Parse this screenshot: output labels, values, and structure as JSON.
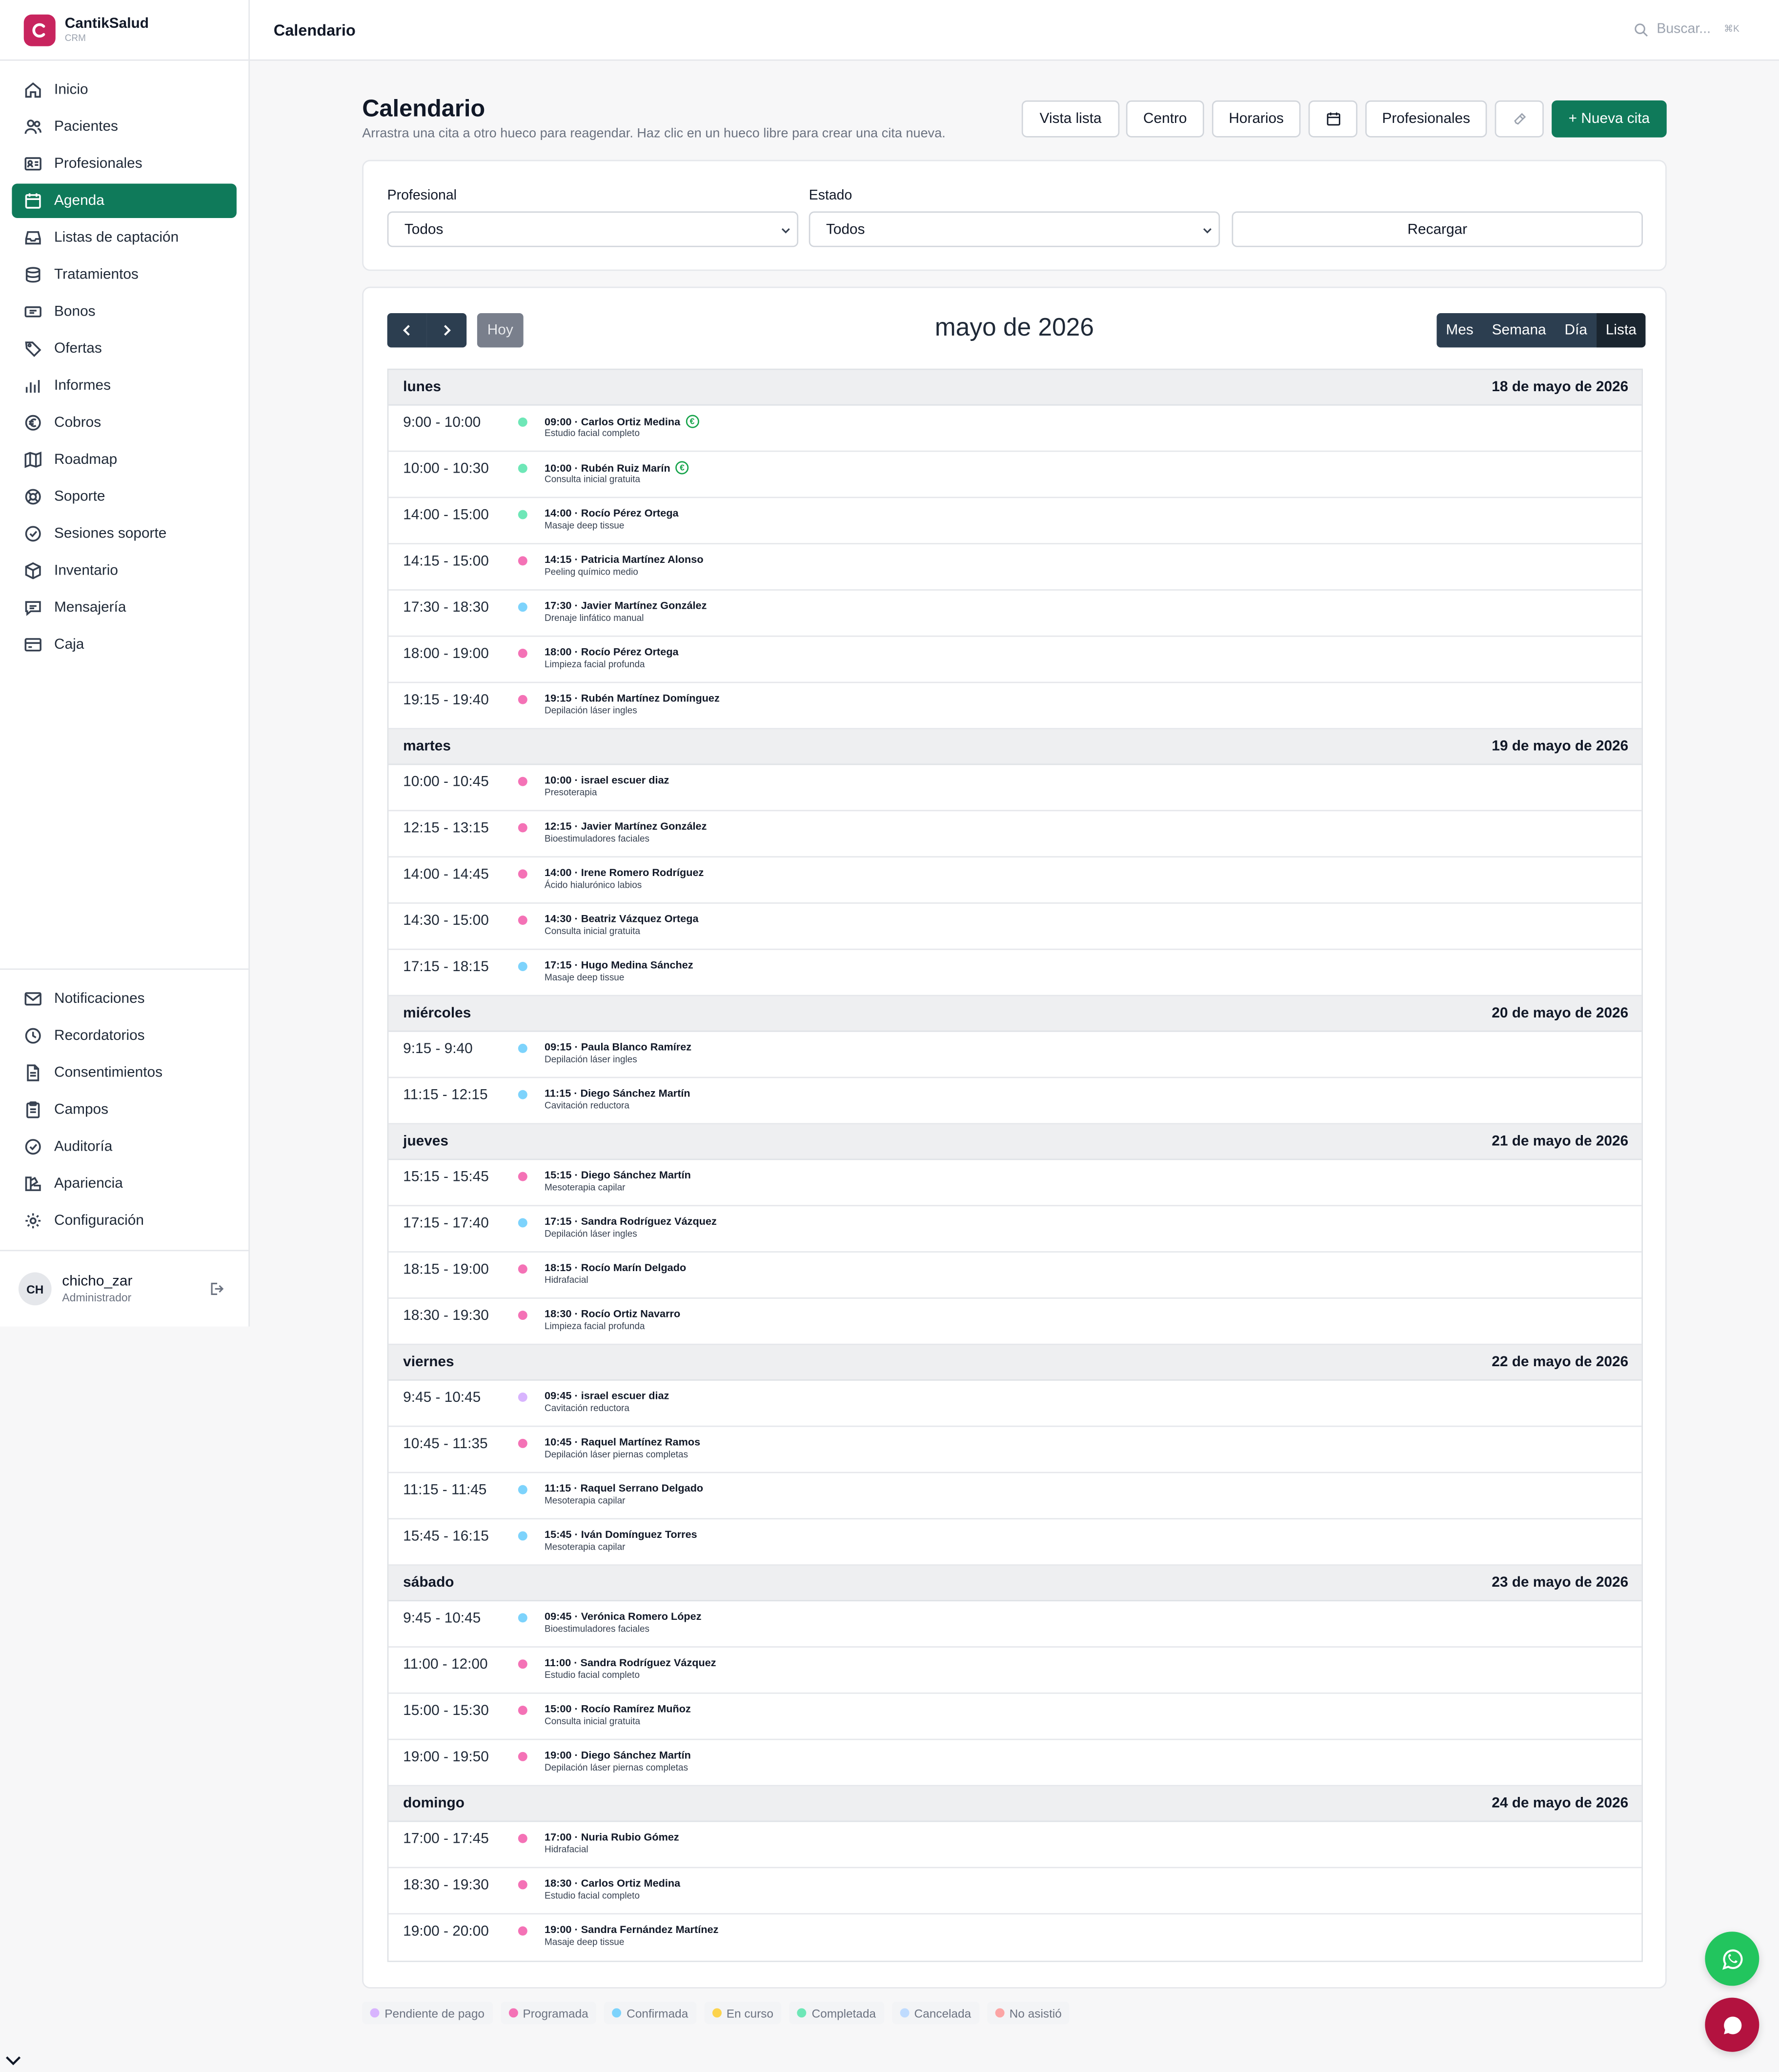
{
  "brand": {
    "name": "CantikSalud",
    "sub": "CRM"
  },
  "topbar": {
    "title": "Calendario",
    "search_placeholder": "Buscar...",
    "shortcut": "⌘K"
  },
  "sidebar": {
    "items": [
      {
        "label": "Inicio",
        "icon": "home-icon"
      },
      {
        "label": "Pacientes",
        "icon": "users-icon"
      },
      {
        "label": "Profesionales",
        "icon": "id-card-icon"
      },
      {
        "label": "Agenda",
        "icon": "calendar-icon",
        "active": true
      },
      {
        "label": "Listas de captación",
        "icon": "inbox-icon"
      },
      {
        "label": "Tratamientos",
        "icon": "database-icon"
      },
      {
        "label": "Bonos",
        "icon": "ticket-icon"
      },
      {
        "label": "Ofertas",
        "icon": "tag-icon"
      },
      {
        "label": "Informes",
        "icon": "chart-icon"
      },
      {
        "label": "Cobros",
        "icon": "euro-icon"
      },
      {
        "label": "Roadmap",
        "icon": "map-icon"
      },
      {
        "label": "Soporte",
        "icon": "lifebuoy-icon"
      },
      {
        "label": "Sesiones soporte",
        "icon": "check-circle-icon"
      },
      {
        "label": "Inventario",
        "icon": "box-icon"
      },
      {
        "label": "Mensajería",
        "icon": "message-icon"
      },
      {
        "label": "Caja",
        "icon": "wallet-icon"
      }
    ],
    "bottom_items": [
      {
        "label": "Notificaciones",
        "icon": "mail-icon"
      },
      {
        "label": "Recordatorios",
        "icon": "clock-icon"
      },
      {
        "label": "Consentimientos",
        "icon": "document-icon"
      },
      {
        "label": "Campos",
        "icon": "clipboard-icon"
      },
      {
        "label": "Auditoría",
        "icon": "shield-check-icon"
      },
      {
        "label": "Apariencia",
        "icon": "palette-icon"
      },
      {
        "label": "Configuración",
        "icon": "gear-icon"
      }
    ],
    "user": {
      "initials": "CH",
      "name": "chicho_zar",
      "role": "Administrador"
    }
  },
  "header": {
    "title": "Calendario",
    "subtitle": "Arrastra una cita a otro hueco para reagendar. Haz clic en un hueco libre para crear una cita nueva.",
    "buttons": {
      "list_view": "Vista lista",
      "center": "Centro",
      "schedules": "Horarios",
      "professionals": "Profesionales",
      "new": "+ Nueva cita"
    }
  },
  "filters": {
    "professional_label": "Profesional",
    "professional_value": "Todos",
    "status_label": "Estado",
    "status_value": "Todos",
    "reload": "Recargar"
  },
  "calendar": {
    "title": "mayo de 2026",
    "today": "Hoy",
    "views": [
      "Mes",
      "Semana",
      "Día",
      "Lista"
    ],
    "active_view": "Lista",
    "days": [
      {
        "name": "lunes",
        "date": "18 de mayo de 2026",
        "events": [
          {
            "time": "9:00 - 10:00",
            "title": "09:00 · Carlos Ortiz Medina",
            "sub": "Estudio facial completo",
            "color": "#6ee7b7",
            "paid": true
          },
          {
            "time": "10:00 - 10:30",
            "title": "10:00 · Rubén Ruiz Marín",
            "sub": "Consulta inicial gratuita",
            "color": "#6ee7b7",
            "paid": true
          },
          {
            "time": "14:00 - 15:00",
            "title": "14:00 · Rocío Pérez Ortega",
            "sub": "Masaje deep tissue",
            "color": "#6ee7b7"
          },
          {
            "time": "14:15 - 15:00",
            "title": "14:15 · Patricia Martínez Alonso",
            "sub": "Peeling químico medio",
            "color": "#f472b6"
          },
          {
            "time": "17:30 - 18:30",
            "title": "17:30 · Javier Martínez González",
            "sub": "Drenaje linfático manual",
            "color": "#7dd3fc"
          },
          {
            "time": "18:00 - 19:00",
            "title": "18:00 · Rocío Pérez Ortega",
            "sub": "Limpieza facial profunda",
            "color": "#f472b6"
          },
          {
            "time": "19:15 - 19:40",
            "title": "19:15 · Rubén Martínez Domínguez",
            "sub": "Depilación láser ingles",
            "color": "#f472b6"
          }
        ]
      },
      {
        "name": "martes",
        "date": "19 de mayo de 2026",
        "events": [
          {
            "time": "10:00 - 10:45",
            "title": "10:00 · israel escuer diaz",
            "sub": "Presoterapia",
            "color": "#f472b6"
          },
          {
            "time": "12:15 - 13:15",
            "title": "12:15 · Javier Martínez González",
            "sub": "Bioestimuladores faciales",
            "color": "#f472b6"
          },
          {
            "time": "14:00 - 14:45",
            "title": "14:00 · Irene Romero Rodríguez",
            "sub": "Ácido hialurónico labios",
            "color": "#f472b6"
          },
          {
            "time": "14:30 - 15:00",
            "title": "14:30 · Beatriz Vázquez Ortega",
            "sub": "Consulta inicial gratuita",
            "color": "#f472b6"
          },
          {
            "time": "17:15 - 18:15",
            "title": "17:15 · Hugo Medina Sánchez",
            "sub": "Masaje deep tissue",
            "color": "#7dd3fc"
          }
        ]
      },
      {
        "name": "miércoles",
        "date": "20 de mayo de 2026",
        "events": [
          {
            "time": "9:15 - 9:40",
            "title": "09:15 · Paula Blanco Ramírez",
            "sub": "Depilación láser ingles",
            "color": "#7dd3fc"
          },
          {
            "time": "11:15 - 12:15",
            "title": "11:15 · Diego Sánchez Martín",
            "sub": "Cavitación reductora",
            "color": "#7dd3fc"
          }
        ]
      },
      {
        "name": "jueves",
        "date": "21 de mayo de 2026",
        "events": [
          {
            "time": "15:15 - 15:45",
            "title": "15:15 · Diego Sánchez Martín",
            "sub": "Mesoterapia capilar",
            "color": "#f472b6"
          },
          {
            "time": "17:15 - 17:40",
            "title": "17:15 · Sandra Rodríguez Vázquez",
            "sub": "Depilación láser ingles",
            "color": "#7dd3fc"
          },
          {
            "time": "18:15 - 19:00",
            "title": "18:15 · Rocío Marín Delgado",
            "sub": "Hidrafacial",
            "color": "#f472b6"
          },
          {
            "time": "18:30 - 19:30",
            "title": "18:30 · Rocío Ortiz Navarro",
            "sub": "Limpieza facial profunda",
            "color": "#f472b6"
          }
        ]
      },
      {
        "name": "viernes",
        "date": "22 de mayo de 2026",
        "events": [
          {
            "time": "9:45 - 10:45",
            "title": "09:45 · israel escuer diaz",
            "sub": "Cavitación reductora",
            "color": "#d8b4fe"
          },
          {
            "time": "10:45 - 11:35",
            "title": "10:45 · Raquel Martínez Ramos",
            "sub": "Depilación láser piernas completas",
            "color": "#f472b6"
          },
          {
            "time": "11:15 - 11:45",
            "title": "11:15 · Raquel Serrano Delgado",
            "sub": "Mesoterapia capilar",
            "color": "#7dd3fc"
          },
          {
            "time": "15:45 - 16:15",
            "title": "15:45 · Iván Domínguez Torres",
            "sub": "Mesoterapia capilar",
            "color": "#7dd3fc"
          }
        ]
      },
      {
        "name": "sábado",
        "date": "23 de mayo de 2026",
        "events": [
          {
            "time": "9:45 - 10:45",
            "title": "09:45 · Verónica Romero López",
            "sub": "Bioestimuladores faciales",
            "color": "#7dd3fc"
          },
          {
            "time": "11:00 - 12:00",
            "title": "11:00 · Sandra Rodríguez Vázquez",
            "sub": "Estudio facial completo",
            "color": "#f472b6"
          },
          {
            "time": "15:00 - 15:30",
            "title": "15:00 · Rocío Ramírez Muñoz",
            "sub": "Consulta inicial gratuita",
            "color": "#f472b6"
          },
          {
            "time": "19:00 - 19:50",
            "title": "19:00 · Diego Sánchez Martín",
            "sub": "Depilación láser piernas completas",
            "color": "#f472b6"
          }
        ]
      },
      {
        "name": "domingo",
        "date": "24 de mayo de 2026",
        "events": [
          {
            "time": "17:00 - 17:45",
            "title": "17:00 · Nuria Rubio Gómez",
            "sub": "Hidrafacial",
            "color": "#f472b6"
          },
          {
            "time": "18:30 - 19:30",
            "title": "18:30 · Carlos Ortiz Medina",
            "sub": "Estudio facial completo",
            "color": "#f472b6"
          },
          {
            "time": "19:00 - 20:00",
            "title": "19:00 · Sandra Fernández Martínez",
            "sub": "Masaje deep tissue",
            "color": "#f472b6"
          }
        ]
      }
    ]
  },
  "legend": [
    {
      "label": "Pendiente de pago",
      "color": "#d8b4fe"
    },
    {
      "label": "Programada",
      "color": "#f472b6"
    },
    {
      "label": "Confirmada",
      "color": "#7dd3fc"
    },
    {
      "label": "En curso",
      "color": "#fcd34d"
    },
    {
      "label": "Completada",
      "color": "#6ee7b7"
    },
    {
      "label": "Cancelada",
      "color": "#bfdbfe"
    },
    {
      "label": "No asistió",
      "color": "#fca5a5"
    }
  ],
  "colors": {
    "brand": "#c8245e",
    "accent": "#0f7a5a",
    "calendar_nav": "#2c3e50",
    "whatsapp": "#22c55e",
    "chat": "#b3123f"
  }
}
